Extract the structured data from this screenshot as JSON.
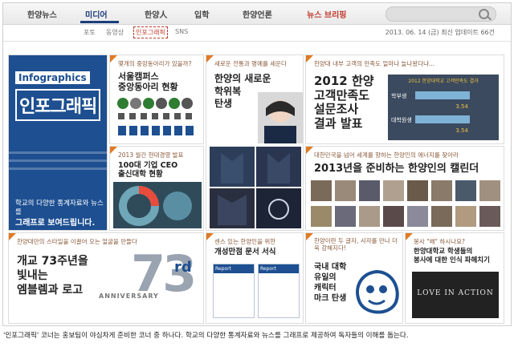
{
  "nav": {
    "items": [
      "한양뉴스",
      "미디어",
      "한양人",
      "입학",
      "한양언론",
      "뉴스 브리핑"
    ],
    "active": "미디어"
  },
  "subnav": {
    "items": [
      "포토",
      "동영상",
      "인포그래픽",
      "SNS"
    ],
    "active": "인포그래픽",
    "update": "2013. 06. 14 (금) 최신 업데이트 66건"
  },
  "tile1": {
    "label_en": "Infographics",
    "label_ko": "인포그래픽",
    "desc1": "학교의 다양한 통계자료와 뉴스를",
    "desc2": "그래프로 보여드립니다."
  },
  "tile2": {
    "caption": "몇개의 중앙동아리가 있을까?",
    "title1": "서울캠퍼스",
    "title2": "중앙동아리 현황"
  },
  "tile3": {
    "caption": "새로운 전통과 명예를 세운다",
    "title": [
      "한양의 새로운",
      "학위복",
      "탄생"
    ]
  },
  "tile4": {
    "caption": "한양대 내부 고객의 만족도 얼마나 늘나왔다냐...",
    "title": [
      "2012 한양",
      "고객만족도",
      "설문조사",
      "결과 발표"
    ]
  },
  "tile5": {
    "caption": "2013 월간 현대경영 발표",
    "title1": "100대 기업 CEO",
    "title2": "출신대학 현황"
  },
  "tile6": {
    "caption": "대한민국을 넘어 세계를 향하는 한양인의 에너지를 찾아라",
    "title": "2013년을 준비하는 한양인의 캘린더"
  },
  "tile7": {
    "caption": "한양대만의 스타일을 이끌어 오는 얼굴을 만들다",
    "title": [
      "개교 73주년을",
      "빛내는",
      "엠블렘과 로고"
    ],
    "num": "73",
    "rd": "rd",
    "anniv": "ANNIVERSARY"
  },
  "tile8": {
    "caption": "센스 있는 한양인을 위한",
    "title": "개성만점 문서 서식",
    "report": "Report"
  },
  "tile9": {
    "caption": "한양이란 두 글자, 사자를 만나 더욱 강해지다!",
    "title": [
      "국내 대학",
      "유일의",
      "캐릭터",
      "마크 탄생"
    ]
  },
  "tile10": {
    "caption": "봉사 \"왜\" 하시나요?",
    "title1": "한양대학교 학생들의",
    "title2": "봉사에 대한 인식 파헤치기",
    "banner": "LOVE IN ACTION"
  },
  "footer": "'인포그래픽' 코너는 홍보팀이 야심차게 준비한 코너 중 하나다. 학교의 다양한 통계자료와 뉴스를 그래프로 제공하여 독자들의 이해를 돕는다.",
  "colors": {
    "accent": "#e07b24",
    "navy": "#1d4f91",
    "brand": "#c0392b"
  },
  "chart_data": {
    "type": "bar",
    "title": "2012 한양대학교 고객만족도 결과",
    "categories": [
      "학부생",
      "대학원생"
    ],
    "series": [
      {
        "values": [
          3.54,
          3.54
        ]
      }
    ],
    "data_labels": [
      "3.54",
      "3.54"
    ],
    "ylim": [
      0,
      5
    ]
  }
}
